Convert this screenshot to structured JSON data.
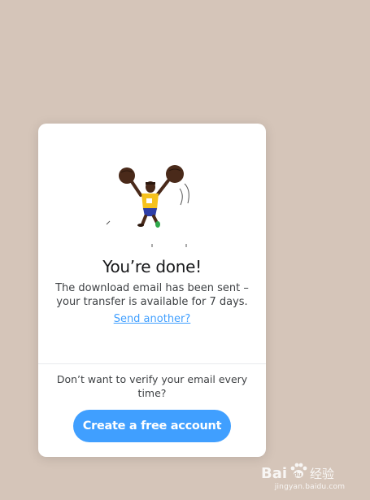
{
  "modal": {
    "title": "You’re done!",
    "message_line1": "The download email has been sent –",
    "message_line2": "your transfer is available for 7 days.",
    "send_another": "Send another?",
    "prompt_line1": "Don’t want to verify your email every",
    "prompt_line2": "time?",
    "cta_label": "Create a free account",
    "illustration": "cheering-runner-illustration"
  },
  "watermark": {
    "brand": "Bai 经验",
    "url": "jingyan.baidu.com"
  },
  "colors": {
    "background": "#d5c5b9",
    "card": "#ffffff",
    "accent": "#409fff",
    "title_text": "#17181a",
    "body_text": "#3e4144"
  }
}
